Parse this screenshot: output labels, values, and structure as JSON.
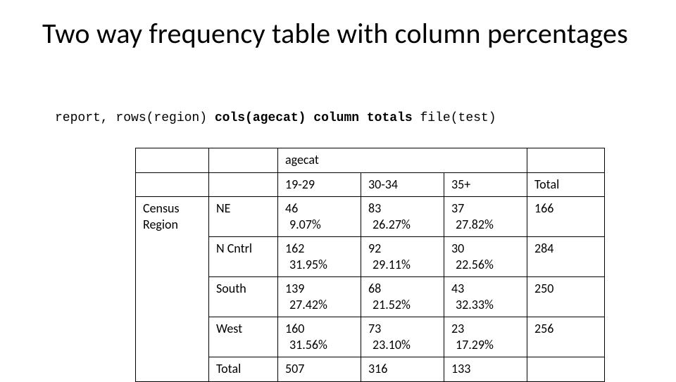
{
  "title": "Two way frequency table with column percentages",
  "code": {
    "pre": "report, rows(region) ",
    "bold": "cols(agecat) column totals",
    "post": " file(test)"
  },
  "table": {
    "top_header": "agecat",
    "col_headers": [
      "19-29",
      "30-34",
      "35+"
    ],
    "total_label": "Total",
    "row_group_label": "Census Region",
    "rows": [
      {
        "label": "NE",
        "cells": [
          {
            "n": "46",
            "p": "9.07%"
          },
          {
            "n": "83",
            "p": "26.27%"
          },
          {
            "n": "37",
            "p": "27.82%"
          }
        ],
        "total": "166"
      },
      {
        "label": "N Cntrl",
        "cells": [
          {
            "n": "162",
            "p": "31.95%"
          },
          {
            "n": "92",
            "p": "29.11%"
          },
          {
            "n": "30",
            "p": "22.56%"
          }
        ],
        "total": "284"
      },
      {
        "label": "South",
        "cells": [
          {
            "n": "139",
            "p": "27.42%"
          },
          {
            "n": "68",
            "p": "21.52%"
          },
          {
            "n": "43",
            "p": "32.33%"
          }
        ],
        "total": "250"
      },
      {
        "label": "West",
        "cells": [
          {
            "n": "160",
            "p": "31.56%"
          },
          {
            "n": "73",
            "p": "23.10%"
          },
          {
            "n": "23",
            "p": "17.29%"
          }
        ],
        "total": "256"
      }
    ],
    "totals_row": {
      "label": "Total",
      "cells": [
        "507",
        "316",
        "133"
      ],
      "total": ""
    }
  }
}
